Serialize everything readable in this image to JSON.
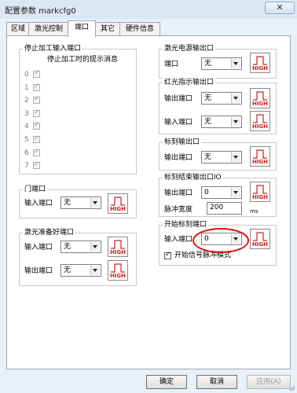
{
  "window": {
    "title": "配置参数 markcfg0",
    "close_glyph": "✕"
  },
  "tabs": [
    "区域",
    "激光控制",
    "端口",
    "其它",
    "硬件信息"
  ],
  "active_tab": "端口",
  "stop_group": {
    "title": "停止加工输入端口",
    "subtitle": "停止加工时的提示消息",
    "rows": [
      "0",
      "1",
      "2",
      "3",
      "4",
      "5",
      "6",
      "7"
    ]
  },
  "door_group": {
    "title": "门端口",
    "label": "输入端口",
    "value": "无"
  },
  "ready_group": {
    "title": "激光准备好端口",
    "rows": [
      {
        "label": "输入端口",
        "value": "无"
      },
      {
        "label": "输出端口",
        "value": "无"
      }
    ]
  },
  "power_group": {
    "title": "激光电源输出口",
    "label": "端口",
    "value": "无"
  },
  "red_group": {
    "title": "红光指示输出口",
    "rows": [
      {
        "label": "输出端口",
        "value": "无"
      },
      {
        "label": "输入端口",
        "value": "无"
      }
    ]
  },
  "mark_group": {
    "title": "标刻输出口",
    "label": "输出端口",
    "value": "无"
  },
  "markend_group": {
    "title": "标刻结束输出口IO",
    "label": "输出端口",
    "value": "0",
    "pulse_label": "脉冲宽度",
    "pulse_value": "200",
    "unit": "ms"
  },
  "start_group": {
    "title": "开始标刻端口",
    "label": "输入端口",
    "value": "0",
    "pulse_mode_label": "开始信号脉冲模式"
  },
  "high_label": "HIGH",
  "buttons": {
    "ok": "确定",
    "cancel": "取消",
    "apply": "应用(A)"
  },
  "colors": {
    "highlight_circle": "#dd1111",
    "high_text": "#cc2222",
    "high_wave": "#cc2222"
  }
}
